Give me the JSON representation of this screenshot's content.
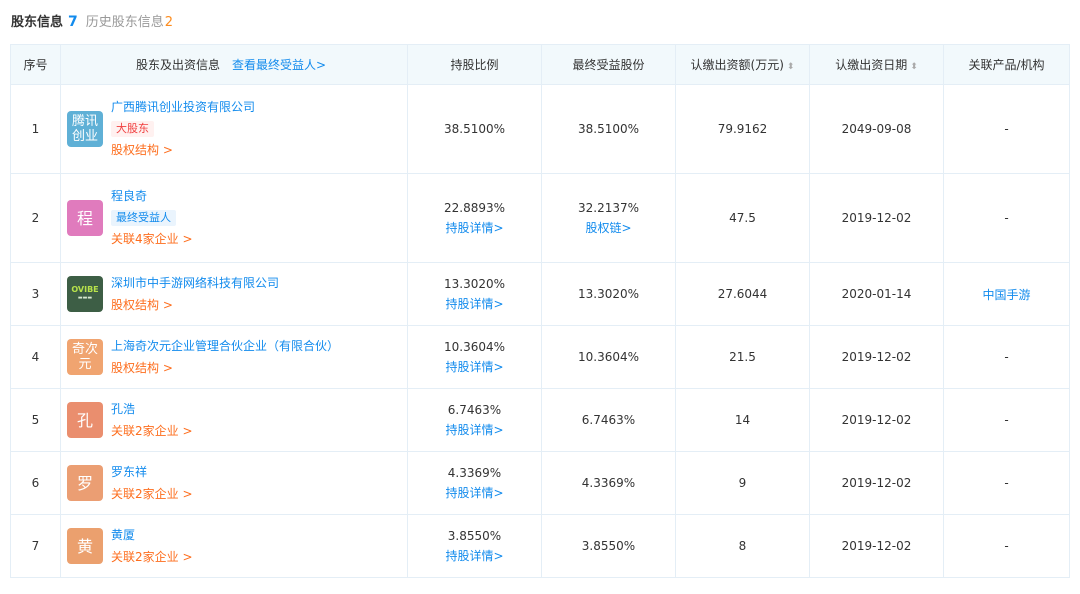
{
  "header": {
    "title": "股东信息",
    "count": "7",
    "history_label": "历史股东信息",
    "history_count": "2"
  },
  "columns": {
    "index": "序号",
    "shareholder": "股东及出资信息",
    "beneficiary_link": "查看最终受益人>",
    "ratio": "持股比例",
    "final_shares": "最终受益股份",
    "capital": "认缴出资额(万元)",
    "date": "认缴出资日期",
    "related": "关联产品/机构"
  },
  "icons": {
    "sort": "sort-icon"
  },
  "colors": {
    "link": "#128bed",
    "orange": "#fd6e1e",
    "tag_red": "#f04040",
    "header_bg": "#f2f9fc"
  },
  "rows": [
    {
      "index": "1",
      "logo": "腾讯创业",
      "logo_color": "#5fb0d6",
      "name": "广西腾讯创业投资有限公司",
      "tag": "大股东",
      "link": "股权结构 >",
      "ratio": "38.5100%",
      "ratio_link": "",
      "final": "38.5100%",
      "final_link": "",
      "capital": "79.9162",
      "date": "2049-09-08",
      "related": "-"
    },
    {
      "index": "2",
      "logo": "程",
      "logo_color": "#e07bbd",
      "name": "程良奇",
      "tag": "最终受益人",
      "link": "关联4家企业 >",
      "ratio": "22.8893%",
      "ratio_link": "持股详情>",
      "final": "32.2137%",
      "final_link": "股权链>",
      "capital": "47.5",
      "date": "2019-12-02",
      "related": "-"
    },
    {
      "index": "3",
      "logo": "",
      "logo_image_text": "OVIBE",
      "name": "深圳市中手游网络科技有限公司",
      "tag": "",
      "link": "股权结构 >",
      "ratio": "13.3020%",
      "ratio_link": "持股详情>",
      "final": "13.3020%",
      "final_link": "",
      "capital": "27.6044",
      "date": "2020-01-14",
      "related": "中国手游"
    },
    {
      "index": "4",
      "logo": "奇次元",
      "logo_color": "#f0a470",
      "name": "上海奇次元企业管理合伙企业（有限合伙）",
      "tag": "",
      "link": "股权结构 >",
      "ratio": "10.3604%",
      "ratio_link": "持股详情>",
      "final": "10.3604%",
      "final_link": "",
      "capital": "21.5",
      "date": "2019-12-02",
      "related": "-"
    },
    {
      "index": "5",
      "logo": "孔",
      "logo_color": "#ea8e6e",
      "name": "孔浩",
      "tag": "",
      "link": "关联2家企业 >",
      "ratio": "6.7463%",
      "ratio_link": "持股详情>",
      "final": "6.7463%",
      "final_link": "",
      "capital": "14",
      "date": "2019-12-02",
      "related": "-"
    },
    {
      "index": "6",
      "logo": "罗",
      "logo_color": "#eb9e73",
      "name": "罗东祥",
      "tag": "",
      "link": "关联2家企业 >",
      "ratio": "4.3369%",
      "ratio_link": "持股详情>",
      "final": "4.3369%",
      "final_link": "",
      "capital": "9",
      "date": "2019-12-02",
      "related": "-"
    },
    {
      "index": "7",
      "logo": "黄",
      "logo_color": "#eba06e",
      "name": "黄厦",
      "tag": "",
      "link": "关联2家企业 >",
      "ratio": "3.8550%",
      "ratio_link": "持股详情>",
      "final": "3.8550%",
      "final_link": "",
      "capital": "8",
      "date": "2019-12-02",
      "related": "-"
    }
  ]
}
